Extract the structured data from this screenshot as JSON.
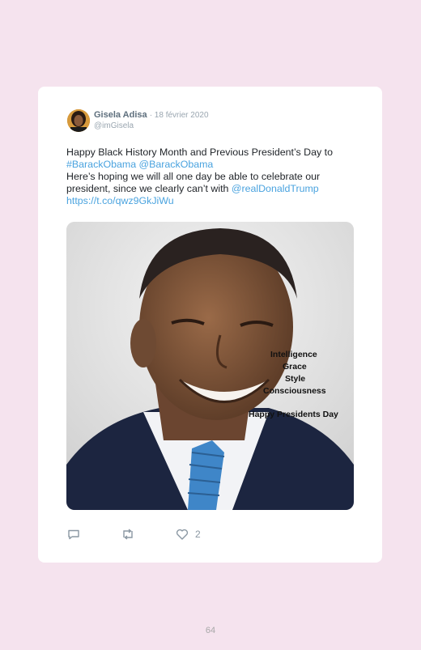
{
  "tweet": {
    "author_name": "Gisela Adisa",
    "date": "· 18 février 2020",
    "handle": "@imGisela",
    "text_line1": "Happy Black History Month and Previous President’s Day to",
    "hashtag": "#BarackObama",
    "mention1": "@BarackObama",
    "text_line3": "Here’s hoping we will all one day be able to celebrate our president, since we clearly can’t with",
    "mention2": "@realDonaldTrump",
    "link": "https://t.co/qwz9GkJiWu",
    "image_overlay": {
      "line1": "Intelligence",
      "line2": "Grace",
      "line3": "Style",
      "line4": "Consciousness",
      "line5": "Happy Presidents Day"
    },
    "like_count": "2"
  },
  "page": {
    "number": "64"
  },
  "icons": [
    "reply-icon",
    "retweet-icon",
    "heart-icon"
  ],
  "colors": {
    "background": "#f5e3ee",
    "link": "#4aa3df",
    "card": "#ffffff"
  }
}
